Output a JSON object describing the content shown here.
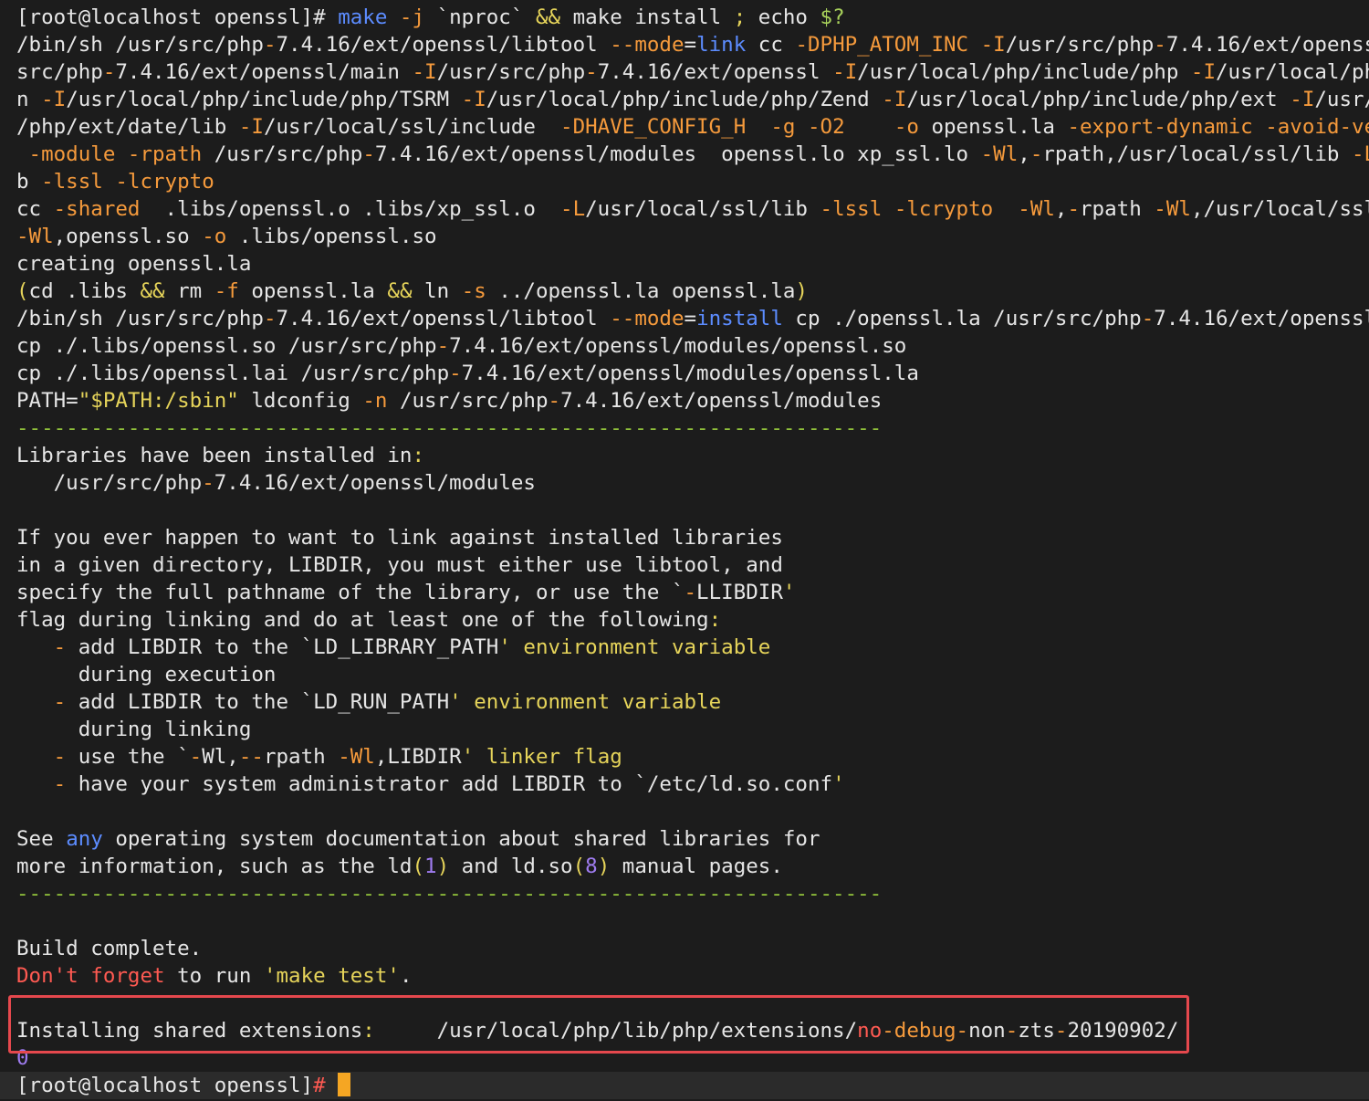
{
  "lines": [
    {
      "prompt": false,
      "parts": [
        [
          "[root@localhost openssl]# ",
          "w"
        ],
        [
          "make",
          "b"
        ],
        [
          " -j",
          "o"
        ],
        [
          " `nproc` ",
          "w"
        ],
        [
          "&&",
          "y"
        ],
        [
          " make install ",
          "w"
        ],
        [
          ";",
          "y"
        ],
        [
          " echo ",
          "w"
        ],
        [
          "$?",
          "g"
        ]
      ]
    },
    {
      "parts": [
        [
          "/bin/sh /usr/src/php",
          "w"
        ],
        [
          "-",
          "o"
        ],
        [
          "7.4.16/ext/openssl/libtool ",
          "w"
        ],
        [
          "--mode",
          "o"
        ],
        [
          "=",
          "w"
        ],
        [
          "link",
          "b"
        ],
        [
          " cc ",
          "w"
        ],
        [
          "-DPHP_ATOM_INC",
          "o"
        ],
        [
          " ",
          "w"
        ],
        [
          "-I",
          "o"
        ],
        [
          "/usr/src/php",
          "w"
        ],
        [
          "-",
          "o"
        ],
        [
          "7.4.16/ext/openss",
          "w"
        ]
      ]
    },
    {
      "parts": [
        [
          "src/php",
          "w"
        ],
        [
          "-",
          "o"
        ],
        [
          "7.4.16/ext/openssl/main ",
          "w"
        ],
        [
          "-I",
          "o"
        ],
        [
          "/usr/src/php",
          "w"
        ],
        [
          "-",
          "o"
        ],
        [
          "7.4.16/ext/openssl ",
          "w"
        ],
        [
          "-I",
          "o"
        ],
        [
          "/usr/local/php/include/php ",
          "w"
        ],
        [
          "-I",
          "o"
        ],
        [
          "/usr/local/ph",
          "w"
        ]
      ]
    },
    {
      "parts": [
        [
          "n ",
          "w"
        ],
        [
          "-I",
          "o"
        ],
        [
          "/usr/local/php/include/php/TSRM ",
          "w"
        ],
        [
          "-I",
          "o"
        ],
        [
          "/usr/local/php/include/php/Zend ",
          "w"
        ],
        [
          "-I",
          "o"
        ],
        [
          "/usr/local/php/include/php/ext ",
          "w"
        ],
        [
          "-I",
          "o"
        ],
        [
          "/usr/",
          "w"
        ]
      ]
    },
    {
      "parts": [
        [
          "/php/ext/date/lib ",
          "w"
        ],
        [
          "-I",
          "o"
        ],
        [
          "/usr/local/ssl/include  ",
          "w"
        ],
        [
          "-DHAVE_CONFIG_H",
          "o"
        ],
        [
          "  ",
          "w"
        ],
        [
          "-g",
          "o"
        ],
        [
          " ",
          "w"
        ],
        [
          "-O2",
          "o"
        ],
        [
          "    ",
          "w"
        ],
        [
          "-o",
          "o"
        ],
        [
          " openssl.la ",
          "w"
        ],
        [
          "-export-dynamic",
          "o"
        ],
        [
          " ",
          "w"
        ],
        [
          "-avoid-ve",
          "o"
        ]
      ]
    },
    {
      "parts": [
        [
          " ",
          "w"
        ],
        [
          "-module",
          "o"
        ],
        [
          " ",
          "w"
        ],
        [
          "-rpath",
          "o"
        ],
        [
          " /usr/src/php",
          "w"
        ],
        [
          "-",
          "o"
        ],
        [
          "7.4.16/ext/openssl/modules  openssl.lo xp_ssl.lo ",
          "w"
        ],
        [
          "-Wl",
          "o"
        ],
        [
          ",",
          "w"
        ],
        [
          "-",
          "o"
        ],
        [
          "rpath,/usr/local/ssl/lib ",
          "w"
        ],
        [
          "-L",
          "o"
        ]
      ]
    },
    {
      "parts": [
        [
          "b ",
          "w"
        ],
        [
          "-lssl",
          "o"
        ],
        [
          " ",
          "w"
        ],
        [
          "-lcrypto",
          "o"
        ]
      ]
    },
    {
      "parts": [
        [
          "cc ",
          "w"
        ],
        [
          "-shared",
          "o"
        ],
        [
          "  .libs/openssl.o .libs/xp_ssl.o  ",
          "w"
        ],
        [
          "-L",
          "o"
        ],
        [
          "/usr/local/ssl/lib ",
          "w"
        ],
        [
          "-lssl",
          "o"
        ],
        [
          " ",
          "w"
        ],
        [
          "-lcrypto",
          "o"
        ],
        [
          "  ",
          "w"
        ],
        [
          "-Wl",
          "o"
        ],
        [
          ",",
          "w"
        ],
        [
          "-",
          "o"
        ],
        [
          "rpath ",
          "w"
        ],
        [
          "-Wl",
          "o"
        ],
        [
          ",/usr/local/ssl",
          "w"
        ]
      ]
    },
    {
      "parts": [
        [
          "-Wl",
          "o"
        ],
        [
          ",openssl.so ",
          "w"
        ],
        [
          "-o",
          "o"
        ],
        [
          " .libs/openssl.so",
          "w"
        ]
      ]
    },
    {
      "parts": [
        [
          "creating openssl.la",
          "w"
        ]
      ]
    },
    {
      "parts": [
        [
          "(",
          "y"
        ],
        [
          "cd .libs ",
          "w"
        ],
        [
          "&&",
          "y"
        ],
        [
          " rm ",
          "w"
        ],
        [
          "-f",
          "o"
        ],
        [
          " openssl.la ",
          "w"
        ],
        [
          "&&",
          "y"
        ],
        [
          " ln ",
          "w"
        ],
        [
          "-s",
          "o"
        ],
        [
          " ../openssl.la openssl.la",
          "w"
        ],
        [
          ")",
          "y"
        ]
      ]
    },
    {
      "parts": [
        [
          "/bin/sh /usr/src/php",
          "w"
        ],
        [
          "-",
          "o"
        ],
        [
          "7.4.16/ext/openssl/libtool ",
          "w"
        ],
        [
          "--mode",
          "o"
        ],
        [
          "=",
          "w"
        ],
        [
          "install",
          "b"
        ],
        [
          " cp ./openssl.la /usr/src/php",
          "w"
        ],
        [
          "-",
          "o"
        ],
        [
          "7.4.16/ext/openssl",
          "w"
        ]
      ]
    },
    {
      "parts": [
        [
          "cp ./.libs/openssl.so /usr/src/php",
          "w"
        ],
        [
          "-",
          "o"
        ],
        [
          "7.4.16/ext/openssl/modules/openssl.so",
          "w"
        ]
      ]
    },
    {
      "parts": [
        [
          "cp ./.libs/openssl.lai /usr/src/php",
          "w"
        ],
        [
          "-",
          "o"
        ],
        [
          "7.4.16/ext/openssl/modules/openssl.la",
          "w"
        ]
      ]
    },
    {
      "parts": [
        [
          "PATH=",
          "w"
        ],
        [
          "\"$PATH:/sbin\"",
          "y"
        ],
        [
          " ldconfig ",
          "w"
        ],
        [
          "-n",
          "o"
        ],
        [
          " /usr/src/php",
          "w"
        ],
        [
          "-",
          "o"
        ],
        [
          "7.4.16/ext/openssl/modules",
          "w"
        ]
      ]
    },
    {
      "parts": [
        [
          "----------------------------------------------------------------------",
          "dash"
        ]
      ]
    },
    {
      "parts": [
        [
          "Libraries have been installed in",
          "w"
        ],
        [
          ":",
          "y"
        ]
      ]
    },
    {
      "parts": [
        [
          "   /usr/src/php",
          "w"
        ],
        [
          "-",
          "o"
        ],
        [
          "7.4.16/ext/openssl/modules",
          "w"
        ]
      ]
    },
    {
      "parts": [
        [
          "",
          "w"
        ]
      ]
    },
    {
      "parts": [
        [
          "If you ever happen to want to link against installed libraries",
          "w"
        ]
      ]
    },
    {
      "parts": [
        [
          "in a given directory, LIBDIR, you must either use libtool, and",
          "w"
        ]
      ]
    },
    {
      "parts": [
        [
          "specify the full pathname of the library, or use the `",
          "w"
        ],
        [
          "-",
          "o"
        ],
        [
          "LLIBDIR",
          "w"
        ],
        [
          "'",
          "y"
        ]
      ]
    },
    {
      "parts": [
        [
          "flag during linking and do at least one of the following",
          "w"
        ],
        [
          ":",
          "y"
        ]
      ]
    },
    {
      "parts": [
        [
          "   ",
          "w"
        ],
        [
          "-",
          "o"
        ],
        [
          " add LIBDIR to the `LD_LIBRARY_PATH",
          "w"
        ],
        [
          "' environment variable",
          "y"
        ]
      ]
    },
    {
      "parts": [
        [
          "     during execution",
          "w"
        ]
      ]
    },
    {
      "parts": [
        [
          "   ",
          "w"
        ],
        [
          "-",
          "o"
        ],
        [
          " add LIBDIR to the `LD_RUN_PATH",
          "w"
        ],
        [
          "' environment variable",
          "y"
        ]
      ]
    },
    {
      "parts": [
        [
          "     during linking",
          "w"
        ]
      ]
    },
    {
      "parts": [
        [
          "   ",
          "w"
        ],
        [
          "-",
          "o"
        ],
        [
          " use the `",
          "w"
        ],
        [
          "-",
          "o"
        ],
        [
          "Wl,",
          "w"
        ],
        [
          "--",
          "o"
        ],
        [
          "rpath ",
          "w"
        ],
        [
          "-Wl",
          "o"
        ],
        [
          ",LIBDIR",
          "w"
        ],
        [
          "' linker flag",
          "y"
        ]
      ]
    },
    {
      "parts": [
        [
          "   ",
          "w"
        ],
        [
          "-",
          "o"
        ],
        [
          " have your system administrator add LIBDIR to `/etc/ld.so.conf",
          "w"
        ],
        [
          "'",
          "y"
        ]
      ]
    },
    {
      "parts": [
        [
          "",
          "w"
        ]
      ]
    },
    {
      "parts": [
        [
          "See ",
          "w"
        ],
        [
          "any",
          "b"
        ],
        [
          " operating system documentation about shared libraries for",
          "w"
        ]
      ]
    },
    {
      "parts": [
        [
          "more information, such as the ld",
          "w"
        ],
        [
          "(",
          "y"
        ],
        [
          "1",
          "p"
        ],
        [
          ")",
          "y"
        ],
        [
          " and ld.so",
          "w"
        ],
        [
          "(",
          "y"
        ],
        [
          "8",
          "p"
        ],
        [
          ")",
          "y"
        ],
        [
          " manual pages.",
          "w"
        ]
      ]
    },
    {
      "parts": [
        [
          "----------------------------------------------------------------------",
          "dash"
        ]
      ]
    },
    {
      "parts": [
        [
          "",
          "w"
        ]
      ]
    },
    {
      "parts": [
        [
          "Build complete.",
          "w"
        ]
      ]
    },
    {
      "parts": [
        [
          "Don't forget",
          "r"
        ],
        [
          " to run ",
          "w"
        ],
        [
          "'make test'",
          "y"
        ],
        [
          ".",
          "w"
        ]
      ]
    },
    {
      "parts": [
        [
          "",
          "w"
        ]
      ]
    },
    {
      "parts": [
        [
          "Installing shared extensions",
          "w"
        ],
        [
          ":",
          "y"
        ],
        [
          "     /usr/local/php/lib/php/extensions/",
          "w"
        ],
        [
          "no",
          "r"
        ],
        [
          "-",
          "o"
        ],
        [
          "debug",
          "o"
        ],
        [
          "-",
          "o"
        ],
        [
          "non",
          "w"
        ],
        [
          "-",
          "o"
        ],
        [
          "zts",
          "w"
        ],
        [
          "-",
          "o"
        ],
        [
          "20190902/",
          "w"
        ]
      ]
    },
    {
      "parts": [
        [
          "0",
          "p"
        ]
      ]
    },
    {
      "prompt": true,
      "parts": [
        [
          "[root@localhost openssl]",
          "w"
        ],
        [
          "# ",
          "r"
        ]
      ]
    }
  ]
}
